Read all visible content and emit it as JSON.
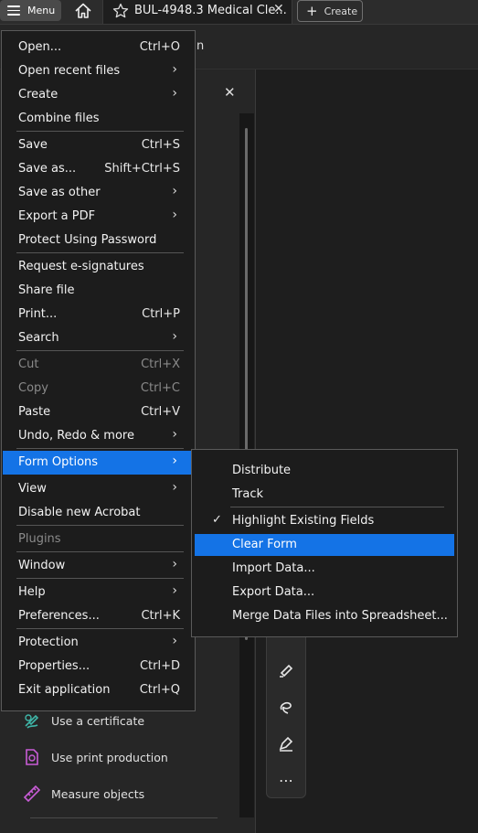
{
  "topbar": {
    "menu_label": "Menu",
    "tab_title": "BUL-4948.3 Medical Cle...",
    "tab_close": "✕",
    "create_label": "Create",
    "create_plus": "+"
  },
  "background": {
    "partial_text": "n",
    "panel_close": "✕",
    "panel_items": [
      {
        "label": "Use a certificate",
        "icon": "certificate-pen-icon"
      },
      {
        "label": "Use print production",
        "icon": "print-production-icon"
      },
      {
        "label": "Measure objects",
        "icon": "ruler-icon"
      }
    ],
    "vtoolbar_more": "⋯"
  },
  "main_menu": {
    "items": [
      {
        "label": "Open...",
        "shortcut": "Ctrl+O"
      },
      {
        "label": "Open recent files",
        "arrow": "›"
      },
      {
        "label": "Create",
        "arrow": "›"
      },
      {
        "label": "Combine files"
      },
      {
        "label": "Save",
        "shortcut": "Ctrl+S"
      },
      {
        "label": "Save as...",
        "shortcut": "Shift+Ctrl+S"
      },
      {
        "label": "Save as other",
        "arrow": "›"
      },
      {
        "label": "Export a PDF",
        "arrow": "›"
      },
      {
        "label": "Protect Using Password"
      },
      {
        "label": "Request e-signatures"
      },
      {
        "label": "Share file"
      },
      {
        "label": "Print...",
        "shortcut": "Ctrl+P"
      },
      {
        "label": "Search",
        "arrow": "›"
      },
      {
        "label": "Cut",
        "shortcut": "Ctrl+X",
        "disabled": true
      },
      {
        "label": "Copy",
        "shortcut": "Ctrl+C",
        "disabled": true
      },
      {
        "label": "Paste",
        "shortcut": "Ctrl+V"
      },
      {
        "label": "Undo, Redo & more",
        "arrow": "›"
      },
      {
        "label": "Form Options",
        "arrow": "›",
        "highlighted": true
      },
      {
        "label": "View",
        "arrow": "›"
      },
      {
        "label": "Disable new Acrobat"
      },
      {
        "label": "Plugins",
        "disabled": true
      },
      {
        "label": "Window",
        "arrow": "›"
      },
      {
        "label": "Help",
        "arrow": "›"
      },
      {
        "label": "Preferences...",
        "shortcut": "Ctrl+K"
      },
      {
        "label": "Protection",
        "arrow": "›"
      },
      {
        "label": "Properties...",
        "shortcut": "Ctrl+D"
      },
      {
        "label": "Exit application",
        "shortcut": "Ctrl+Q"
      }
    ]
  },
  "form_options_menu": {
    "items": [
      {
        "label": "Distribute"
      },
      {
        "label": "Track"
      },
      {
        "label": "Highlight Existing Fields",
        "checked": true,
        "check": "✓"
      },
      {
        "label": "Clear Form",
        "highlighted": true
      },
      {
        "label": "Import Data..."
      },
      {
        "label": "Export Data..."
      },
      {
        "label": "Merge Data Files into Spreadsheet..."
      }
    ]
  },
  "colors": {
    "highlight": "#1473e6",
    "menu_bg": "#1c1c1c",
    "app_bg": "#1e1e1e"
  }
}
